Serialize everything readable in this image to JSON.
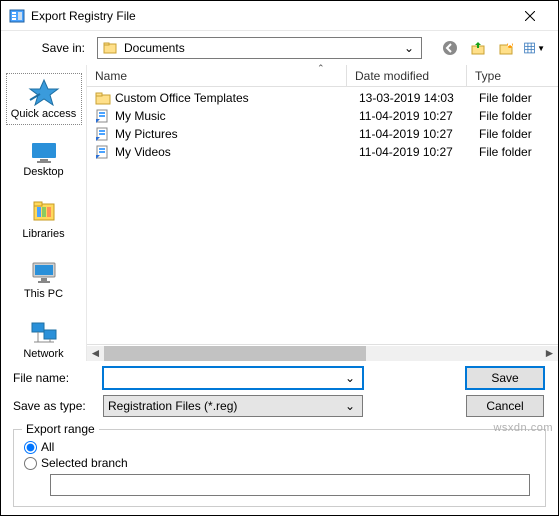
{
  "window": {
    "title": "Export Registry File"
  },
  "savein": {
    "label": "Save in:",
    "value": "Documents"
  },
  "columns": {
    "name": "Name",
    "date": "Date modified",
    "type": "Type"
  },
  "sidebar": {
    "items": [
      {
        "label": "Quick access"
      },
      {
        "label": "Desktop"
      },
      {
        "label": "Libraries"
      },
      {
        "label": "This PC"
      },
      {
        "label": "Network"
      }
    ]
  },
  "files": [
    {
      "icon": "folder",
      "name": "Custom Office Templates",
      "date": "13-03-2019 14:03",
      "type": "File folder"
    },
    {
      "icon": "shortcut",
      "name": "My Music",
      "date": "11-04-2019 10:27",
      "type": "File folder"
    },
    {
      "icon": "shortcut",
      "name": "My Pictures",
      "date": "11-04-2019 10:27",
      "type": "File folder"
    },
    {
      "icon": "shortcut",
      "name": "My Videos",
      "date": "11-04-2019 10:27",
      "type": "File folder"
    }
  ],
  "form": {
    "filename_label": "File name:",
    "filename_value": "",
    "type_label": "Save as type:",
    "type_value": "Registration Files (*.reg)",
    "save": "Save",
    "cancel": "Cancel"
  },
  "export": {
    "legend": "Export range",
    "all": "All",
    "selected": "Selected branch",
    "branch_value": ""
  },
  "watermark": "wsxdn.com"
}
